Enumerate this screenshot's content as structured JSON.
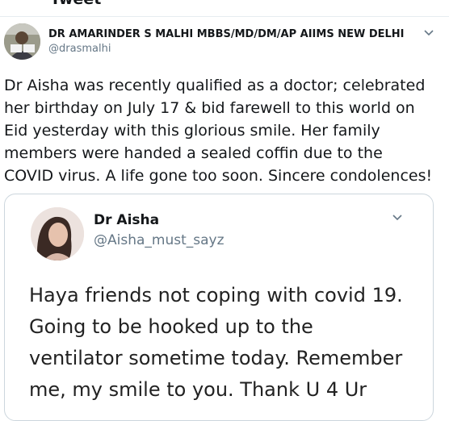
{
  "page": {
    "header_title": "Tweet"
  },
  "tweet": {
    "author_name": "DR AMARINDER S MALHI MBBS/MD/DM/AP AIIMS NEW DELHI",
    "author_handle": "@drasmalhi",
    "text_lines": [
      "Dr Aisha was recently qualified as a doctor; celebrated",
      "her birthday on July 17 & bid farewell to this world on",
      "Eid yesterday with this glorious smile. Her family",
      "members were handed a sealed coffin due to the",
      "COVID virus. A life gone too soon. Sincere condolences!"
    ]
  },
  "quoted": {
    "author_name": "Dr Aisha",
    "author_handle": "@Aisha_must_sayz",
    "text_lines": [
      "Haya friends not coping with covid 19.",
      "Going to be hooked up to the",
      "ventilator sometime today. Remember",
      "me, my smile to you.  Thank U 4 Ur"
    ]
  },
  "icons": {
    "menu": "chevron-down-icon",
    "author_avatar": "avatar",
    "quoted_avatar": "avatar"
  },
  "colors": {
    "text": "#14171a",
    "muted": "#657786",
    "border": "#ccd6dd"
  }
}
